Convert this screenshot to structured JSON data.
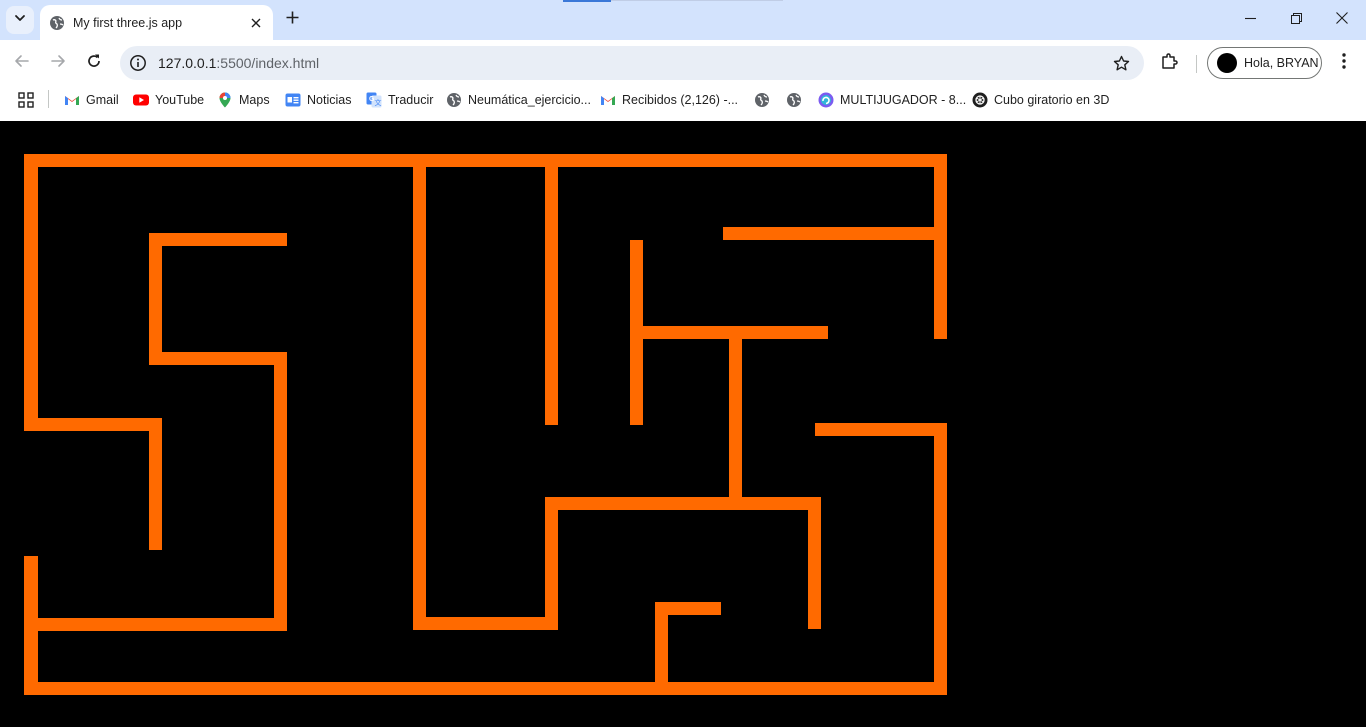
{
  "browser": {
    "tab": {
      "title": "My first three.js app"
    },
    "url": {
      "host": "127.0.0.1",
      "path": ":5500/index.html"
    },
    "profile": {
      "label": "Hola, BRYAN"
    },
    "bookmarks": [
      {
        "label": "Gmail",
        "icon": "gmail-icon"
      },
      {
        "label": "YouTube",
        "icon": "youtube-icon"
      },
      {
        "label": "Maps",
        "icon": "maps-icon"
      },
      {
        "label": "Noticias",
        "icon": "news-icon"
      },
      {
        "label": "Traducir",
        "icon": "translate-icon"
      },
      {
        "label": "Neumática_ejercicio...",
        "icon": "globe-icon"
      },
      {
        "label": "Recibidos (2,126) -...",
        "icon": "gmail-icon"
      },
      {
        "label": "",
        "icon": "globe-icon"
      },
      {
        "label": "",
        "icon": "globe-icon"
      },
      {
        "label": "MULTIJUGADOR - 8...",
        "icon": "edge-icon"
      },
      {
        "label": "Cubo giratorio en 3D",
        "icon": "openai-icon"
      }
    ]
  },
  "scene": {
    "background": "#000000",
    "wall_color": "#ff6a00"
  }
}
